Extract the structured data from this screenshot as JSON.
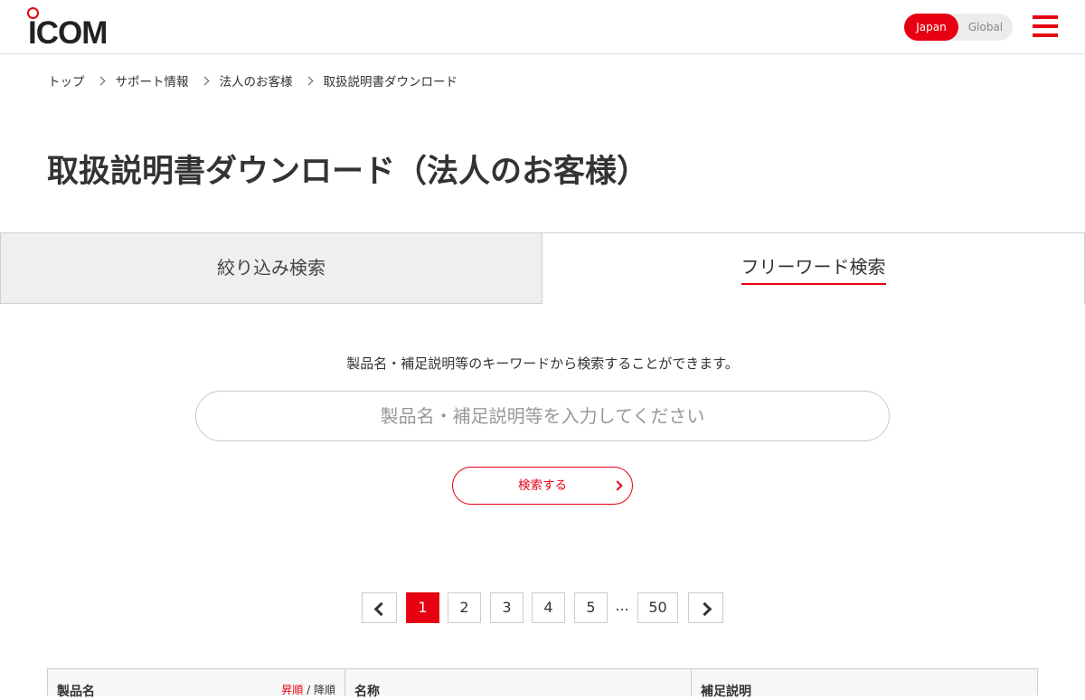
{
  "header": {
    "logo_text": "ICOM",
    "region": {
      "japan": "Japan",
      "global": "Global"
    }
  },
  "breadcrumb": [
    "トップ",
    "サポート情報",
    "法人のお客様",
    "取扱説明書ダウンロード"
  ],
  "page_title": "取扱説明書ダウンロード（法人のお客様）",
  "tabs": {
    "filter": "絞り込み検索",
    "freeword": "フリーワード検索"
  },
  "search": {
    "description": "製品名・補足説明等のキーワードから検索することができます。",
    "placeholder": "製品名・補足説明等を入力してください",
    "button": "検索する"
  },
  "pagination": {
    "pages": [
      "1",
      "2",
      "3",
      "4",
      "5"
    ],
    "ellipsis": "...",
    "last": "50",
    "current": "1"
  },
  "table": {
    "headers": {
      "product": "製品名",
      "name": "名称",
      "note": "補足説明"
    },
    "sort": {
      "asc": "昇順",
      "desc": "降順",
      "sep": "/"
    }
  },
  "colors": {
    "accent": "#e60012"
  }
}
